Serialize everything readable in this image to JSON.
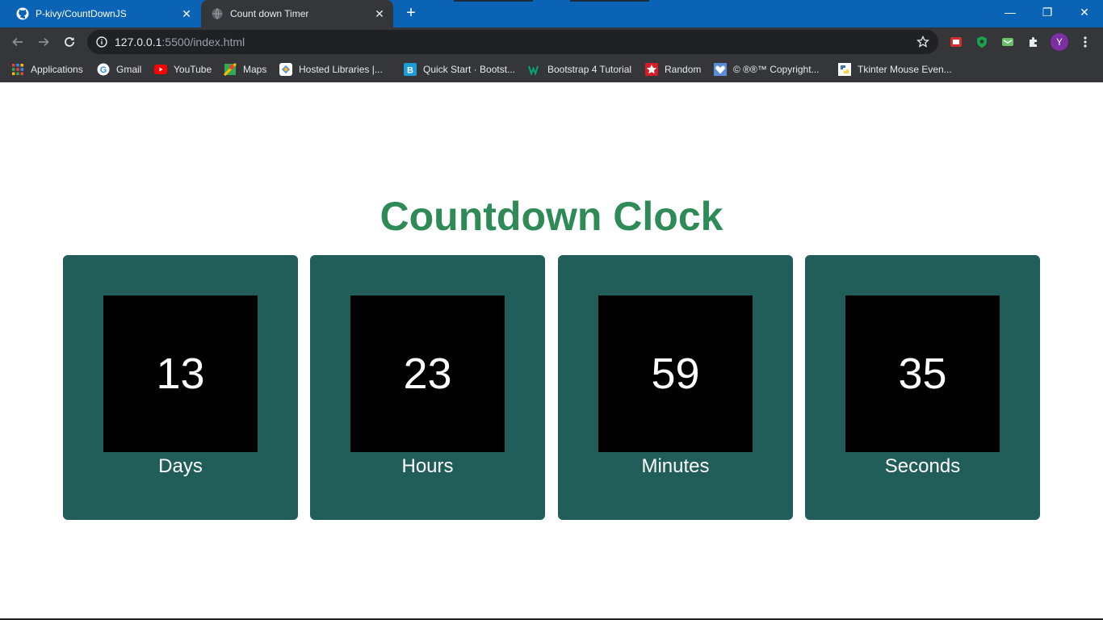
{
  "browser": {
    "tabs": [
      {
        "title": "P-kivy/CountDownJS",
        "icon": "github-icon",
        "active": false
      },
      {
        "title": "Count down Timer",
        "icon": "globe-icon",
        "active": true
      }
    ],
    "new_tab_symbol": "+",
    "window_controls": {
      "minimize": "—",
      "restore": "❐",
      "close": "✕"
    },
    "url": {
      "host": "127.0.0.1",
      "path": ":5500/index.html"
    },
    "profile_initial": "Y",
    "bookmarks": [
      {
        "label": "Applications",
        "icon": "apps-grid-icon"
      },
      {
        "label": "Gmail",
        "icon": "google-icon"
      },
      {
        "label": "YouTube",
        "icon": "youtube-icon"
      },
      {
        "label": "Maps",
        "icon": "maps-icon"
      },
      {
        "label": "Hosted Libraries |...",
        "icon": "hosted-libraries-icon"
      },
      {
        "label": "Quick Start · Bootst...",
        "icon": "bootstrap-icon"
      },
      {
        "label": "Bootstrap 4 Tutorial",
        "icon": "w3schools-icon"
      },
      {
        "label": "Random",
        "icon": "star-icon"
      },
      {
        "label": "© ®®™ Copyright...",
        "icon": "heart-icon"
      },
      {
        "label": "Tkinter Mouse Even...",
        "icon": "python-icon"
      }
    ]
  },
  "page": {
    "title": "Countdown Clock",
    "countdown": [
      {
        "value": "13",
        "label": "Days"
      },
      {
        "value": "23",
        "label": "Hours"
      },
      {
        "value": "59",
        "label": "Minutes"
      },
      {
        "value": "35",
        "label": "Seconds"
      }
    ]
  },
  "colors": {
    "title_green": "#2e8b57",
    "card_bg": "#215e59",
    "digit_bg": "#000000",
    "chrome_blue": "#0b63b5",
    "chrome_dark": "#35363a"
  }
}
